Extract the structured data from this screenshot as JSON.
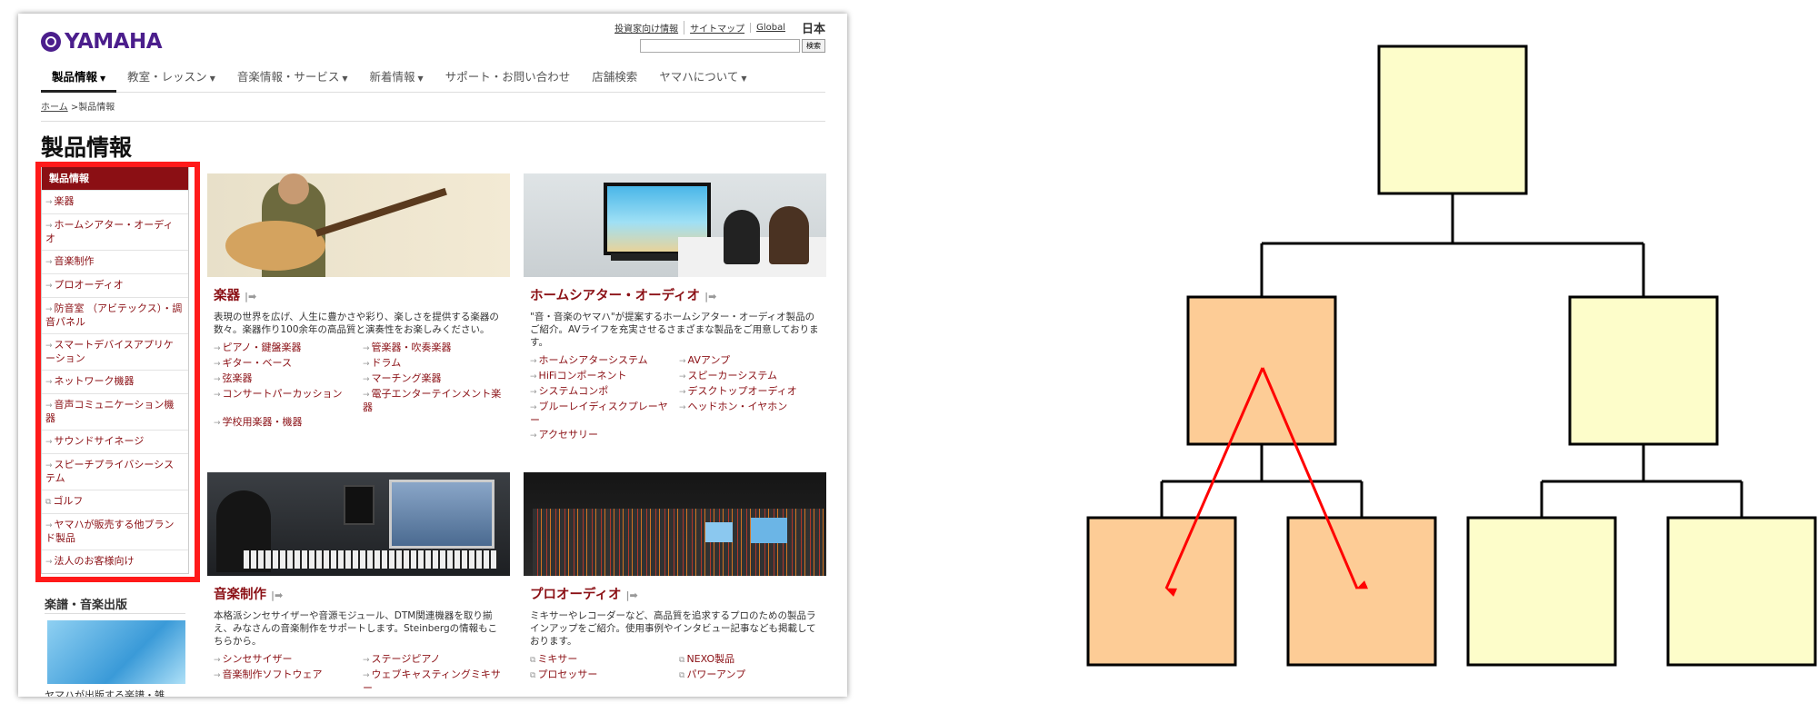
{
  "logo": {
    "text": "YAMAHA"
  },
  "utility_links": [
    "投資家向け情報",
    "サイトマップ",
    "Global"
  ],
  "language": "日本",
  "search": {
    "button": "検索",
    "value": ""
  },
  "global_nav": [
    {
      "label": "製品情報",
      "dropdown": true,
      "active": true
    },
    {
      "label": "教室・レッスン",
      "dropdown": true
    },
    {
      "label": "音楽情報・サービス",
      "dropdown": true
    },
    {
      "label": "新着情報",
      "dropdown": true
    },
    {
      "label": "サポート・お問い合わせ",
      "dropdown": false
    },
    {
      "label": "店舗検索",
      "dropdown": false
    },
    {
      "label": "ヤマハについて",
      "dropdown": true
    }
  ],
  "breadcrumb": {
    "home": "ホーム",
    "current": ">製品情報"
  },
  "page_title": "製品情報",
  "side_nav": {
    "head": "製品情報",
    "items": [
      "楽器",
      "ホームシアター・オーディオ",
      "音楽制作",
      "プロオーディオ",
      "防音室 （アビテックス）・調音パネル",
      "スマートデバイスアプリケーション",
      "ネットワーク機器",
      "音声コミュニケーション機器",
      "サウンドサイネージ",
      "スピーチプライバシーシステム",
      "ゴルフ",
      "ヤマハが販売する他ブランド製品",
      "法人のお客様向け"
    ]
  },
  "publication": {
    "title": "楽譜・音楽出版",
    "text": "ヤマハが出版する楽譜・雑"
  },
  "tiles": {
    "instruments": {
      "title": "楽器",
      "desc": "表現の世界を広げ、人生に豊かさや彩り、楽しさを提供する楽器の数々。楽器作り100余年の高品質と演奏性をお楽しみください。",
      "links": [
        "ピアノ・鍵盤楽器",
        "管楽器・吹奏楽器",
        "ギター・ベース",
        "ドラム",
        "弦楽器",
        "マーチング楽器",
        "コンサートパーカッション",
        "電子エンターテインメント楽器",
        "学校用楽器・機器"
      ]
    },
    "home_theater": {
      "title": "ホームシアター・オーディオ",
      "desc": "\"音・音楽のヤマハ\"が提案するホームシアター・オーディオ製品のご紹介。AVライフを充実させるさまざまな製品をご用意しております。",
      "links": [
        "ホームシアターシステム",
        "AVアンプ",
        "HiFiコンポーネント",
        "スピーカーシステム",
        "システムコンポ",
        "デスクトップオーディオ",
        "ブルーレイディスクプレーヤー",
        "ヘッドホン・イヤホン",
        "アクセサリー"
      ]
    },
    "music_production": {
      "title": "音楽制作",
      "desc": "本格派シンセサイザーや音源モジュール、DTM関連機器を取り揃え、みなさんの音楽制作をサポートします。Steinbergの情報もこちらから。",
      "links": [
        "シンセサイザー",
        "ステージピアノ",
        "音楽制作ソフトウェア",
        "ウェブキャスティングミキサー"
      ]
    },
    "pro_audio": {
      "title": "プロオーディオ",
      "desc": "ミキサーやレコーダーなど、高品質を追求するプロのための製品ラインアップをご紹介。使用事例やインタビュー記事なども掲載しております。",
      "links": [
        "ミキサー",
        "NEXO製品",
        "プロセッサー",
        "パワーアンプ"
      ]
    }
  },
  "diagram_colors": {
    "highlight": "#fdcc96",
    "normal": "#fdfdca",
    "arrow": "#ff0000",
    "line": "#000000"
  }
}
